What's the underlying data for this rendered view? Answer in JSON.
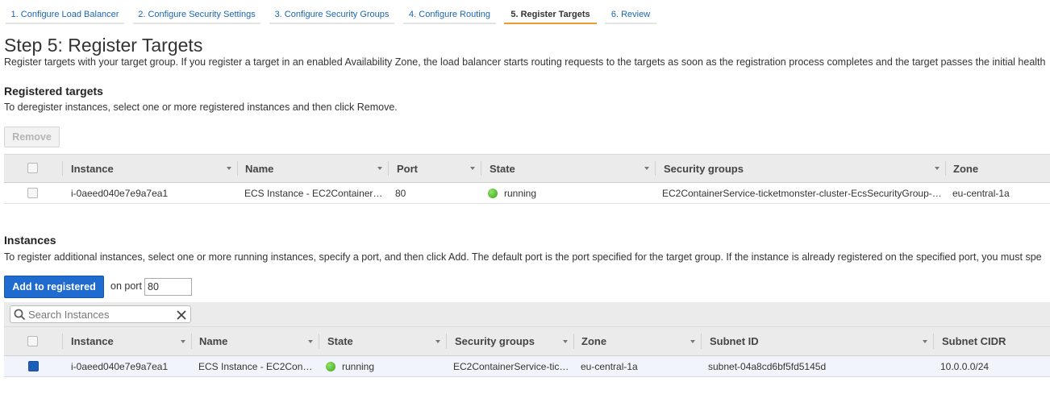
{
  "wizard": {
    "tabs": [
      {
        "label": "1. Configure Load Balancer"
      },
      {
        "label": "2. Configure Security Settings"
      },
      {
        "label": "3. Configure Security Groups"
      },
      {
        "label": "4. Configure Routing"
      },
      {
        "label": "5. Register Targets",
        "active": true
      },
      {
        "label": "6. Review"
      }
    ]
  },
  "page": {
    "title": "Step 5: Register Targets",
    "description": "Register targets with your target group. If you register a target in an enabled Availability Zone, the load balancer starts routing requests to the targets as soon as the registration process completes and the target passes the initial health"
  },
  "registered": {
    "heading": "Registered targets",
    "hint": "To deregister instances, select one or more registered instances and then click Remove.",
    "remove_label": "Remove",
    "columns": [
      "Instance",
      "Name",
      "Port",
      "State",
      "Security groups",
      "Zone"
    ],
    "rows": [
      {
        "instance": "i-0aeed040e7e9a7ea1",
        "name": "ECS Instance - EC2Container…",
        "port": "80",
        "state": "running",
        "security_groups": "EC2ContainerService-ticketmonster-cluster-EcsSecurityGroup-…",
        "zone": "eu-central-1a"
      }
    ]
  },
  "instances": {
    "heading": "Instances",
    "hint": "To register additional instances, select one or more running instances, specify a port, and then click Add. The default port is the port specified for the target group. If the instance is already registered on the specified port, you must spe",
    "add_label": "Add to registered",
    "on_port_label": "on port",
    "port_value": "80",
    "search_placeholder": "Search Instances",
    "columns": [
      "Instance",
      "Name",
      "State",
      "Security groups",
      "Zone",
      "Subnet ID",
      "Subnet CIDR"
    ],
    "rows": [
      {
        "instance": "i-0aeed040e7e9a7ea1",
        "name": "ECS Instance - EC2Con…",
        "state": "running",
        "security_groups": "EC2ContainerService-tic…",
        "zone": "eu-central-1a",
        "subnet_id": "subnet-04a8cd6bf5fd5145d",
        "subnet_cidr": "10.0.0.0/24",
        "selected": true
      }
    ]
  },
  "colors": {
    "accent": "#1f6bd0",
    "active_tab": "#ec9c2e",
    "running": "#3da516"
  }
}
